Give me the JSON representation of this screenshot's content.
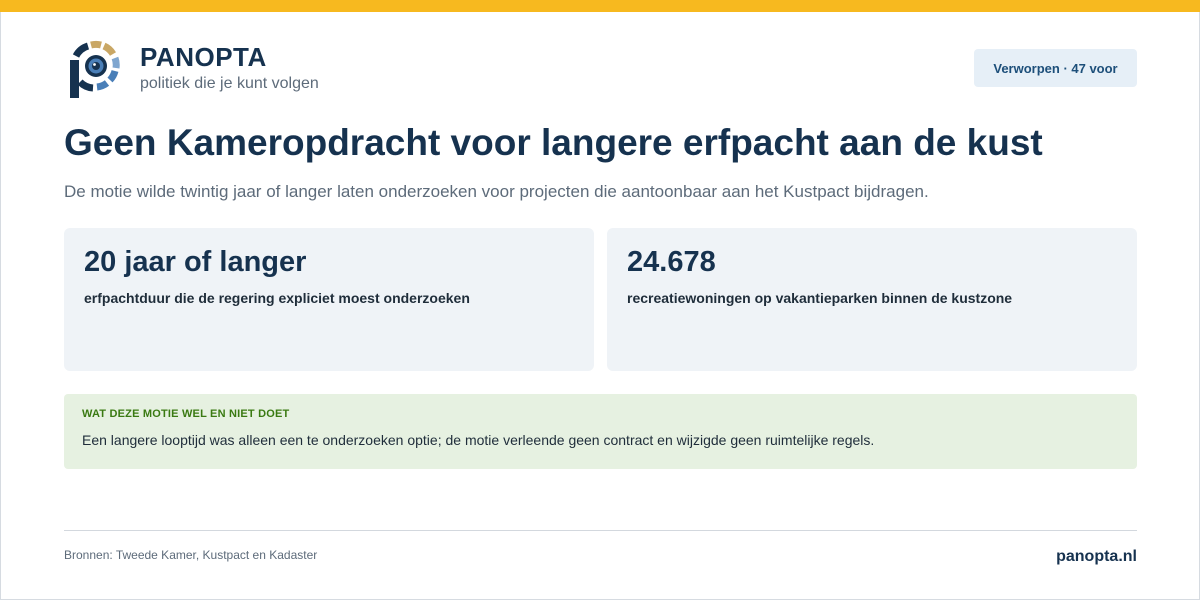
{
  "brand": {
    "name": "PANOPTA",
    "tagline": "politiek die je kunt volgen",
    "logo_icon": "eye-p-logo-icon",
    "colors": {
      "navy": "#16324f",
      "accent_gold": "#f7b91f",
      "ring_gold": "#c9a765",
      "ring_blue": "#4a7fb8"
    }
  },
  "status": {
    "label": "Verworpen · 47 voor"
  },
  "headline": {
    "title": "Geen Kameropdracht voor langere erfpacht aan de kust",
    "subtitle": "De motie wilde twintig jaar of langer laten onderzoeken voor projecten die aantoonbaar aan het Kustpact bijdragen."
  },
  "stats": [
    {
      "value": "20 jaar of langer",
      "label": "erfpachtduur die de regering expliciet moest onderzoeken"
    },
    {
      "value": "24.678",
      "label": "recreatiewoningen op vakantieparken binnen de kustzone"
    }
  ],
  "note": {
    "heading": "WAT DEZE MOTIE WEL EN NIET DOET",
    "text": "Een langere looptijd was alleen een te onderzoeken optie; de motie verleende geen contract en wijzigde geen ruimtelijke regels."
  },
  "footer": {
    "sources": "Bronnen: Tweede Kamer, Kustpact en Kadaster",
    "site": "panopta.nl"
  }
}
